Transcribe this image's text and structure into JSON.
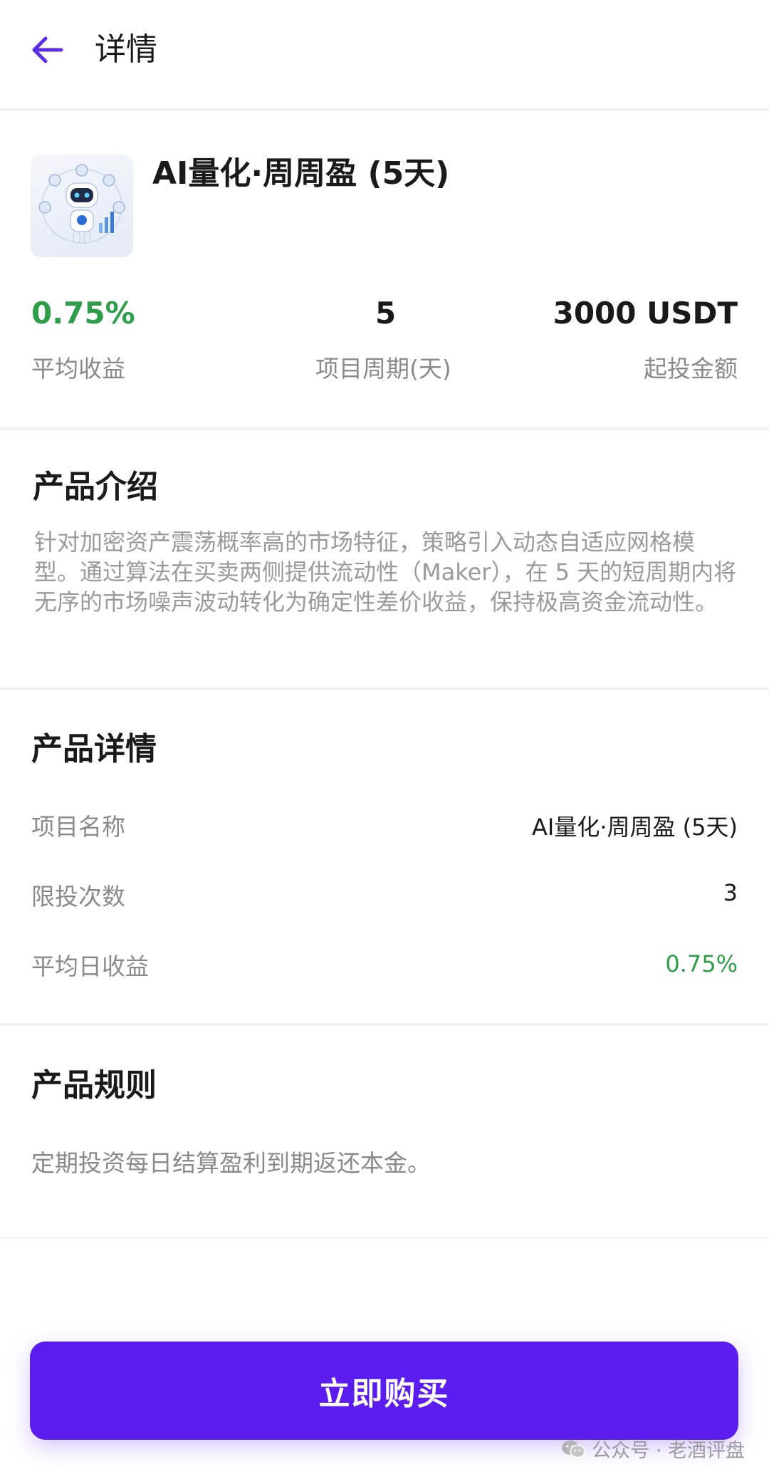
{
  "header": {
    "title": "详情"
  },
  "product": {
    "name": "AI量化·周周盈 (5天)",
    "stats": [
      {
        "value": "0.75%",
        "label": "平均收益"
      },
      {
        "value": "5",
        "label": "项目周期(天)"
      },
      {
        "value": "3000 USDT",
        "label": "起投金额"
      }
    ]
  },
  "intro": {
    "title": "产品介绍",
    "text": "针对加密资产震荡概率高的市场特征，策略引入动态自适应网格模型。通过算法在买卖两侧提供流动性（Maker），在 5 天的短周期内将无序的市场噪声波动转化为确定性差价收益，保持极高资金流动性。"
  },
  "details": {
    "title": "产品详情",
    "rows": [
      {
        "label": "项目名称",
        "value": "AI量化·周周盈 (5天)"
      },
      {
        "label": "限投次数",
        "value": "3"
      },
      {
        "label": "平均日收益",
        "value": "0.75%"
      }
    ]
  },
  "rules": {
    "title": "产品规则",
    "text": "定期投资每日结算盈利到期返还本金。"
  },
  "buy_button": {
    "label": "立即购买"
  },
  "watermark": {
    "text": "公众号 · 老酒评盘"
  },
  "colors": {
    "accent": "#5b1cf0",
    "positive": "#2e9e4a",
    "back_arrow": "#5b2ee6"
  },
  "icons": {
    "back": "arrow-left-icon",
    "thumbnail": "ai-robot-image",
    "watermark": "wechat-icon"
  }
}
